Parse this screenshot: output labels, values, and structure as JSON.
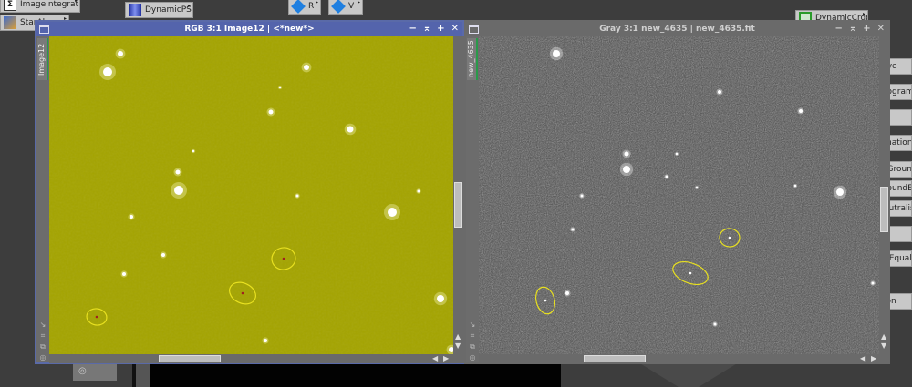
{
  "process_icons_top": [
    {
      "label": "ImageIntegration",
      "icon": "integration-icon"
    },
    {
      "label": "StarAl",
      "icon": "star-alignment-icon"
    },
    {
      "label": "DynamicPSF",
      "icon": "psf-icon"
    },
    {
      "label": "R",
      "icon": "cube-icon"
    },
    {
      "label": "V",
      "icon": "cube-icon"
    },
    {
      "label": "DynamicCrop",
      "icon": "crop-icon"
    }
  ],
  "process_icons_right": [
    "rve",
    "togram",
    "y",
    "mation",
    "tGroun",
    "roundE",
    "eutralis",
    "n",
    "nEquali",
    "ion"
  ],
  "left_window": {
    "title": "RGB 3:1 Image12 | <*new*>",
    "tab": "Image12",
    "color": "#a4a400"
  },
  "right_window": {
    "title": "Gray 3:1 new_4635 | new_4635.fit",
    "tab": "new_4635"
  },
  "title_buttons": [
    "−",
    "⌅",
    "+",
    "✕"
  ]
}
